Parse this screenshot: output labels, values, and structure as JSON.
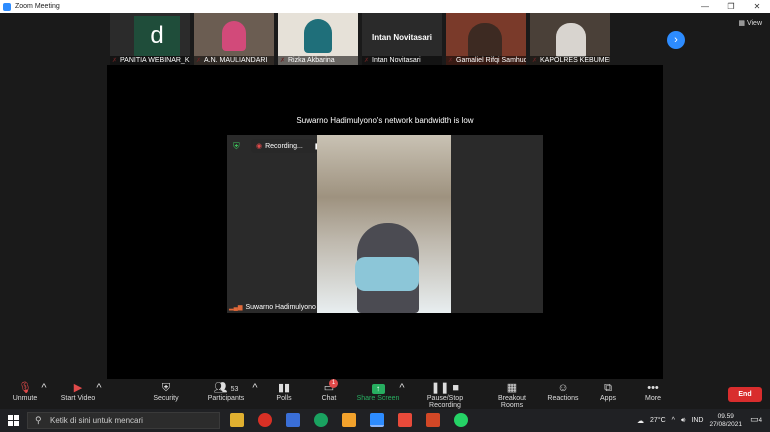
{
  "window": {
    "title": "Zoom Meeting"
  },
  "participants_strip": [
    {
      "name": "PANITIA WEBINAR_KK...",
      "avatar_letter": "d",
      "bg": "#1f4d3a"
    },
    {
      "name": "A.N. MAULIANDARI",
      "bg": "#6b5d52"
    },
    {
      "name": "Rizka Akbarina",
      "bg": "#e6e1d8"
    },
    {
      "name": "Intan Novitasari",
      "caption": "Intan Novitasari",
      "bg": "#2a2a2a"
    },
    {
      "name": "Gamaliel Rifqi Samhudi",
      "bg": "#7a3a2a"
    },
    {
      "name": "KAPOLRES KEBUMEN",
      "bg": "#4a4038"
    }
  ],
  "view_label": "View",
  "main": {
    "notice": "Suwarno Hadimulyono's network bandwidth is low",
    "recording_label": "Recording...",
    "speaker_name": "Suwarno Hadimulyono"
  },
  "toolbar": {
    "unmute": "Unmute",
    "start_video": "Start Video",
    "security": "Security",
    "participants": "Participants",
    "participants_count": "53",
    "polls": "Polls",
    "chat": "Chat",
    "chat_badge": "1",
    "share_screen": "Share Screen",
    "pause_stop_recording": "Pause/Stop Recording",
    "breakout_rooms": "Breakout Rooms",
    "reactions": "Reactions",
    "apps": "Apps",
    "more": "More",
    "end": "End"
  },
  "taskbar": {
    "search_placeholder": "Ketik di sini untuk mencari",
    "weather": "27°C",
    "language": "IND",
    "time": "09.59",
    "date": "27/08/2021",
    "notification_count": "4"
  },
  "colors": {
    "accent": "#2d8cff",
    "end": "#d92d2d",
    "share": "#27ae60"
  }
}
